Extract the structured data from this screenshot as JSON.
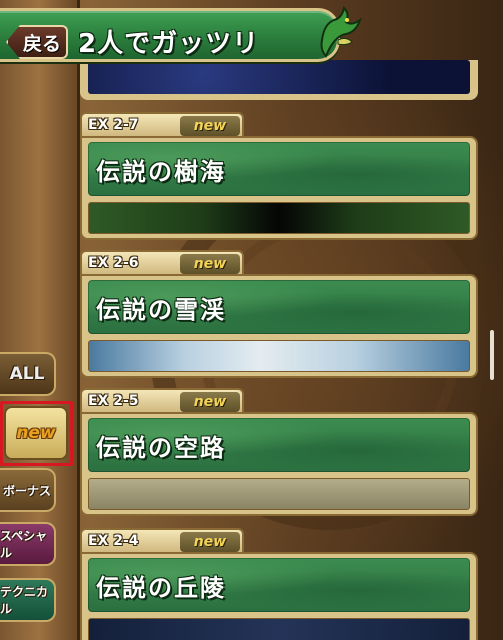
{
  "header": {
    "back_label": "戻る",
    "title": "2人でガッツリ"
  },
  "categories": {
    "all": "ALL",
    "new": "new",
    "bonus": "ボーナス",
    "special": "スペシャル",
    "technical": "テクニカル"
  },
  "dungeons": [
    {
      "code": "EX 2-7",
      "badge": "new",
      "name": "伝説の樹海",
      "banner": "forest"
    },
    {
      "code": "EX 2-6",
      "badge": "new",
      "name": "伝説の雪渓",
      "banner": "snow"
    },
    {
      "code": "EX 2-5",
      "badge": "new",
      "name": "伝説の空路",
      "banner": "sky"
    },
    {
      "code": "EX 2-4",
      "badge": "new",
      "name": "伝説の丘陵",
      "banner": "hill"
    }
  ],
  "colors": {
    "header_green": "#2b7e3c",
    "card_frame": "#d8c489",
    "new_badge_text": "#f2d458",
    "selection_highlight": "#d81820"
  }
}
